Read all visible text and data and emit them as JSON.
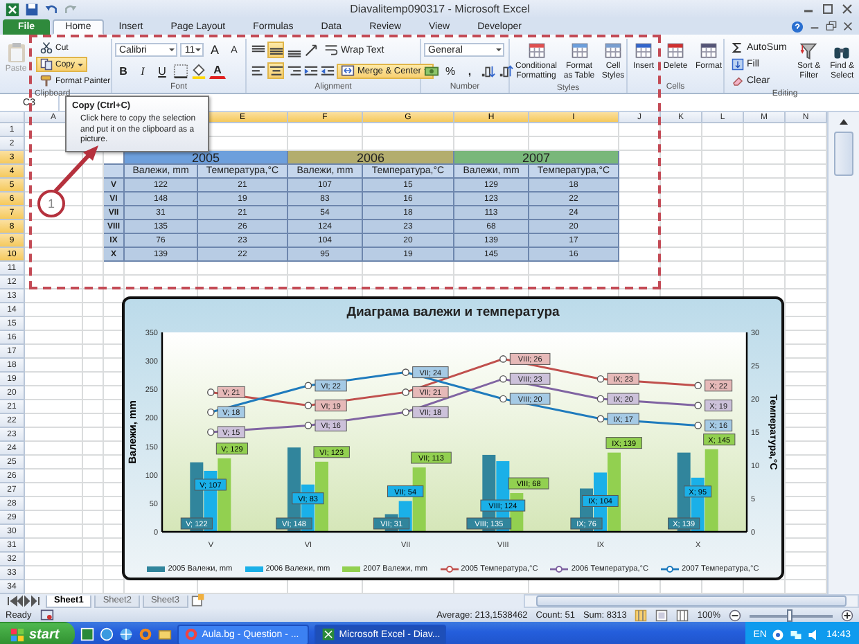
{
  "window": {
    "title": "Diavalitemp090317 - Microsoft Excel"
  },
  "tabs": [
    {
      "label": "File",
      "kind": "backstage",
      "selected": false
    },
    {
      "label": "Home",
      "kind": "tab",
      "selected": true
    },
    {
      "label": "Insert",
      "kind": "tab",
      "selected": false
    },
    {
      "label": "Page Layout",
      "kind": "tab",
      "selected": false
    },
    {
      "label": "Formulas",
      "kind": "tab",
      "selected": false
    },
    {
      "label": "Data",
      "kind": "tab",
      "selected": false
    },
    {
      "label": "Review",
      "kind": "tab",
      "selected": false
    },
    {
      "label": "View",
      "kind": "tab",
      "selected": false
    },
    {
      "label": "Developer",
      "kind": "tab",
      "selected": false
    }
  ],
  "ribbon": {
    "clipboard": {
      "label": "Clipboard",
      "paste": {
        "label": "Paste",
        "disabled": true
      },
      "cut": "Cut",
      "copy": {
        "label": "Copy",
        "hovered": true
      },
      "format_painter": "Format Painter"
    },
    "font": {
      "label": "Font",
      "family": "Calibri",
      "size": "11",
      "grow": "A",
      "shrink": "A",
      "bold": "B",
      "italic": "I",
      "underline": "U",
      "font_color": "A"
    },
    "alignment": {
      "label": "Alignment",
      "wrap_text": "Wrap Text",
      "merge": {
        "label": "Merge & Center",
        "active": true
      },
      "buttons": [
        {
          "active": false
        },
        {
          "active": true
        },
        {
          "active": false
        },
        {
          "active": false
        },
        {
          "active": true
        },
        {
          "active": false
        }
      ]
    },
    "number": {
      "label": "Number",
      "format": "General",
      "percent": "%",
      "comma": ","
    },
    "styles": {
      "label": "Styles",
      "buttons": [
        "Conditional Formatting",
        "Format as Table",
        "Cell Styles"
      ]
    },
    "cells": {
      "label": "Cells",
      "buttons": [
        "Insert",
        "Delete",
        "Format"
      ]
    },
    "editing": {
      "label": "Editing",
      "autosum": "AutoSum",
      "fill": "Fill",
      "clear": "Clear",
      "sort": "Sort & Filter",
      "find": "Find & Select"
    }
  },
  "name_box": "C3",
  "tooltip": {
    "title": "Copy (Ctrl+C)",
    "text": "Click here to copy the selection and put it on the clipboard as a picture."
  },
  "annotation": {
    "label": "1"
  },
  "sheet": {
    "columns": [
      {
        "label": "A",
        "selected": false
      },
      {
        "label": "E",
        "selected": true
      },
      {
        "label": "F",
        "selected": true
      },
      {
        "label": "G",
        "selected": true
      },
      {
        "label": "H",
        "selected": true
      },
      {
        "label": "I",
        "selected": true
      },
      {
        "label": "J",
        "selected": false
      },
      {
        "label": "K",
        "selected": false
      },
      {
        "label": "L",
        "selected": false
      },
      {
        "label": "M",
        "selected": false
      },
      {
        "label": "N",
        "selected": false
      }
    ],
    "rows": [
      {
        "label": "1",
        "selected": false
      },
      {
        "label": "2",
        "selected": false
      },
      {
        "label": "3",
        "selected": true
      },
      {
        "label": "4",
        "selected": true
      },
      {
        "label": "5",
        "selected": true
      },
      {
        "label": "6",
        "selected": true
      },
      {
        "label": "7",
        "selected": true
      },
      {
        "label": "8",
        "selected": true
      },
      {
        "label": "9",
        "selected": true
      },
      {
        "label": "10",
        "selected": true
      },
      {
        "label": "11",
        "selected": false
      },
      {
        "label": "12",
        "selected": false
      },
      {
        "label": "13",
        "selected": false
      },
      {
        "label": "14",
        "selected": false
      },
      {
        "label": "15",
        "selected": false
      },
      {
        "label": "16",
        "selected": false
      },
      {
        "label": "17",
        "selected": false
      },
      {
        "label": "18",
        "selected": false
      },
      {
        "label": "19",
        "selected": false
      },
      {
        "label": "20",
        "selected": false
      },
      {
        "label": "21",
        "selected": false
      },
      {
        "label": "22",
        "selected": false
      },
      {
        "label": "23",
        "selected": false
      },
      {
        "label": "24",
        "selected": false
      },
      {
        "label": "25",
        "selected": false
      },
      {
        "label": "26",
        "selected": false
      },
      {
        "label": "27",
        "selected": false
      },
      {
        "label": "28",
        "selected": false
      },
      {
        "label": "29",
        "selected": false
      },
      {
        "label": "30",
        "selected": false
      },
      {
        "label": "31",
        "selected": false
      },
      {
        "label": "32",
        "selected": false
      },
      {
        "label": "33",
        "selected": false
      },
      {
        "label": "34",
        "selected": false
      }
    ]
  },
  "table": {
    "years": [
      {
        "label": "2005",
        "color": "#6d9fdc"
      },
      {
        "label": "2006",
        "color": "#b3ad6e"
      },
      {
        "label": "2007",
        "color": "#79b77a"
      }
    ],
    "subheaders": [
      "Валежи, mm",
      "Температура,°C",
      "Валежи, mm",
      "Температура,°C",
      "Валежи, mm",
      "Температура,°C"
    ],
    "rows": [
      {
        "label": "V",
        "values": [
          "122",
          "21",
          "107",
          "15",
          "129",
          "18"
        ]
      },
      {
        "label": "VI",
        "values": [
          "148",
          "19",
          "83",
          "16",
          "123",
          "22"
        ]
      },
      {
        "label": "VII",
        "values": [
          "31",
          "21",
          "54",
          "18",
          "113",
          "24"
        ]
      },
      {
        "label": "VIII",
        "values": [
          "135",
          "26",
          "124",
          "23",
          "68",
          "20"
        ]
      },
      {
        "label": "IX",
        "values": [
          "76",
          "23",
          "104",
          "20",
          "139",
          "17"
        ]
      },
      {
        "label": "X",
        "values": [
          "139",
          "22",
          "95",
          "19",
          "145",
          "16"
        ]
      }
    ]
  },
  "chart": {
    "chart_data": {
      "type": "bar",
      "title": "Диаграма валежи и температура",
      "ylabel": "Валежи, mm",
      "y2label": "Температура,°C",
      "categories": [
        "V",
        "VI",
        "VII",
        "VIII",
        "IX",
        "X"
      ],
      "legend": "bottom",
      "ylim": [
        0,
        350
      ],
      "yticks": [
        0,
        50,
        100,
        150,
        200,
        250,
        300,
        350
      ],
      "y2lim": [
        0,
        30
      ],
      "y2ticks": [
        0,
        5,
        10,
        15,
        20,
        25,
        30
      ],
      "data_labels": true,
      "series": [
        {
          "name": "2005 Валежи, mm",
          "type": "bar",
          "color": "#31859c",
          "values": [
            122,
            148,
            31,
            135,
            76,
            139
          ],
          "value_labels": [
            "V; 122",
            "VI; 148",
            "VII; 31",
            "VIII; 135",
            "IX; 76",
            "X; 139"
          ]
        },
        {
          "name": "2006 Валежи, mm",
          "type": "bar",
          "color": "#1ab0e8",
          "values": [
            107,
            83,
            54,
            124,
            104,
            95
          ],
          "value_labels": [
            "V; 107",
            "VI; 83",
            "VII; 54",
            "VIII; 124",
            "IX; 104",
            "X; 95"
          ]
        },
        {
          "name": "2007 Валежи, mm",
          "type": "bar",
          "color": "#92d050",
          "values": [
            129,
            123,
            113,
            68,
            139,
            145
          ],
          "value_labels": [
            "V; 129",
            "VI; 123",
            "VII; 113",
            "VIII; 68",
            "IX; 139",
            "X; 145"
          ]
        },
        {
          "name": "2005 Температура,°C",
          "type": "line",
          "axis": "y2",
          "marker": "circle",
          "color": "#c0504d",
          "values": [
            21,
            19,
            21,
            26,
            23,
            22
          ],
          "value_labels": [
            "V; 21",
            "VI; 19",
            "VII; 21",
            "VIII; 26",
            "IX; 23",
            "X; 22"
          ]
        },
        {
          "name": "2006 Температура,°C",
          "type": "line",
          "axis": "y2",
          "marker": "circle",
          "color": "#8064a2",
          "values": [
            15,
            16,
            18,
            23,
            20,
            19
          ],
          "value_labels": [
            "V; 15",
            "VI; 16",
            "VII; 18",
            "VIII; 23",
            "IX; 20",
            "X; 19"
          ]
        },
        {
          "name": "2007 Температура,°C",
          "type": "line",
          "axis": "y2",
          "marker": "circle",
          "color": "#1f7bbd",
          "values": [
            18,
            22,
            24,
            20,
            17,
            16
          ],
          "value_labels": [
            "V; 18",
            "VI; 22",
            "VII; 24",
            "VIII; 20",
            "IX; 17",
            "X; 16"
          ]
        }
      ]
    }
  },
  "sheet_tabs": [
    {
      "label": "Sheet1",
      "selected": true
    },
    {
      "label": "Sheet2",
      "selected": false
    },
    {
      "label": "Sheet3",
      "selected": false
    }
  ],
  "status_bar": {
    "mode": "Ready",
    "average": "Average: 213,1538462",
    "count": "Count: 51",
    "sum": "Sum: 8313",
    "zoom": {
      "label": "100%",
      "level": 0.5
    }
  },
  "taskbar": {
    "start": "start",
    "tasks": [
      {
        "label": "Aula.bg - Question - ...",
        "selected": false
      },
      {
        "label": "Microsoft Excel - Diav...",
        "selected": true
      }
    ],
    "language": "EN",
    "clock": "14:43"
  }
}
